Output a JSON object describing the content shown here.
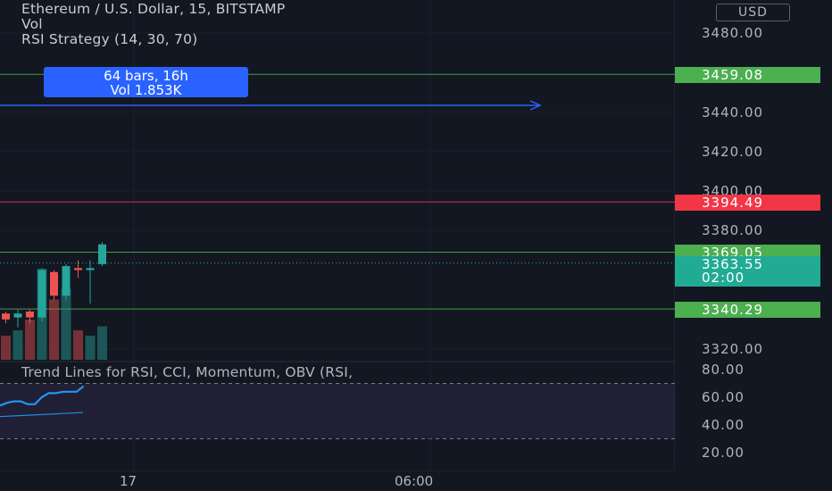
{
  "legend": {
    "symbol": "Ethereum / U.S. Dollar, 15, BITSTAMP",
    "volume": "Vol",
    "strategy": "RSI Strategy (14, 30, 70)"
  },
  "currency_button": "USD",
  "measure": {
    "line1": "64 bars, 16h",
    "line2": "Vol 1.853K"
  },
  "rsi_panel": {
    "title": "Trend Lines for RSI, CCI, Momentum, OBV (RSI,"
  },
  "price_axis": {
    "labels": [
      "3480.00",
      "3440.00",
      "3420.00",
      "3400.00",
      "3380.00",
      "3320.00"
    ]
  },
  "rsi_axis": {
    "labels": [
      "80.00",
      "60.00",
      "40.00",
      "20.00"
    ]
  },
  "time_axis": {
    "labels": [
      "17",
      "06:00"
    ]
  },
  "price_tags": [
    {
      "text": "3459.08",
      "color": "#4caf50"
    },
    {
      "text": "3394.49",
      "color": "#f23645"
    },
    {
      "text": "3369.05",
      "color": "#4caf50"
    },
    {
      "text": "3363.55",
      "sub": "02:00",
      "color": "#22ab94"
    },
    {
      "text": "3340.29",
      "color": "#4caf50"
    }
  ],
  "colors": {
    "up": "#26a69a",
    "down": "#ef5350",
    "background": "#131722",
    "rsi_line": "#2196f3",
    "rsi_band": "#7e57c2"
  },
  "chart_data": {
    "type": "candlestick",
    "candles": [
      {
        "open": 3338,
        "close": 3335,
        "high": 3339,
        "low": 3333
      },
      {
        "open": 3336,
        "close": 3338,
        "high": 3340,
        "low": 3331
      },
      {
        "open": 3339,
        "close": 3336,
        "high": 3340,
        "low": 3333
      },
      {
        "open": 3336,
        "close": 3360,
        "high": 3361,
        "low": 3334
      },
      {
        "open": 3359,
        "close": 3347,
        "high": 3360,
        "low": 3345
      },
      {
        "open": 3347,
        "close": 3362,
        "high": 3363,
        "low": 3345
      },
      {
        "open": 3361,
        "close": 3360,
        "high": 3365,
        "low": 3356
      },
      {
        "open": 3360,
        "close": 3361,
        "high": 3365,
        "low": 3343
      },
      {
        "open": 3363,
        "close": 3373,
        "high": 3374,
        "low": 3362
      }
    ],
    "volume_relative": [
      0.18,
      0.22,
      0.3,
      0.68,
      0.45,
      0.53,
      0.22,
      0.18,
      0.25
    ],
    "rsi_series": [
      54,
      56,
      57,
      57,
      55,
      55,
      60,
      63,
      63,
      64,
      64,
      64,
      68
    ],
    "rsi_signal": [
      46,
      46.5,
      47,
      47.5,
      48,
      48.5,
      49
    ],
    "levels": [
      3459.08,
      3394.49,
      3369.05,
      3340.29
    ],
    "current_price": 3363.55,
    "ylim": [
      3315,
      3495
    ],
    "rsi_ylim": [
      15,
      85
    ]
  }
}
